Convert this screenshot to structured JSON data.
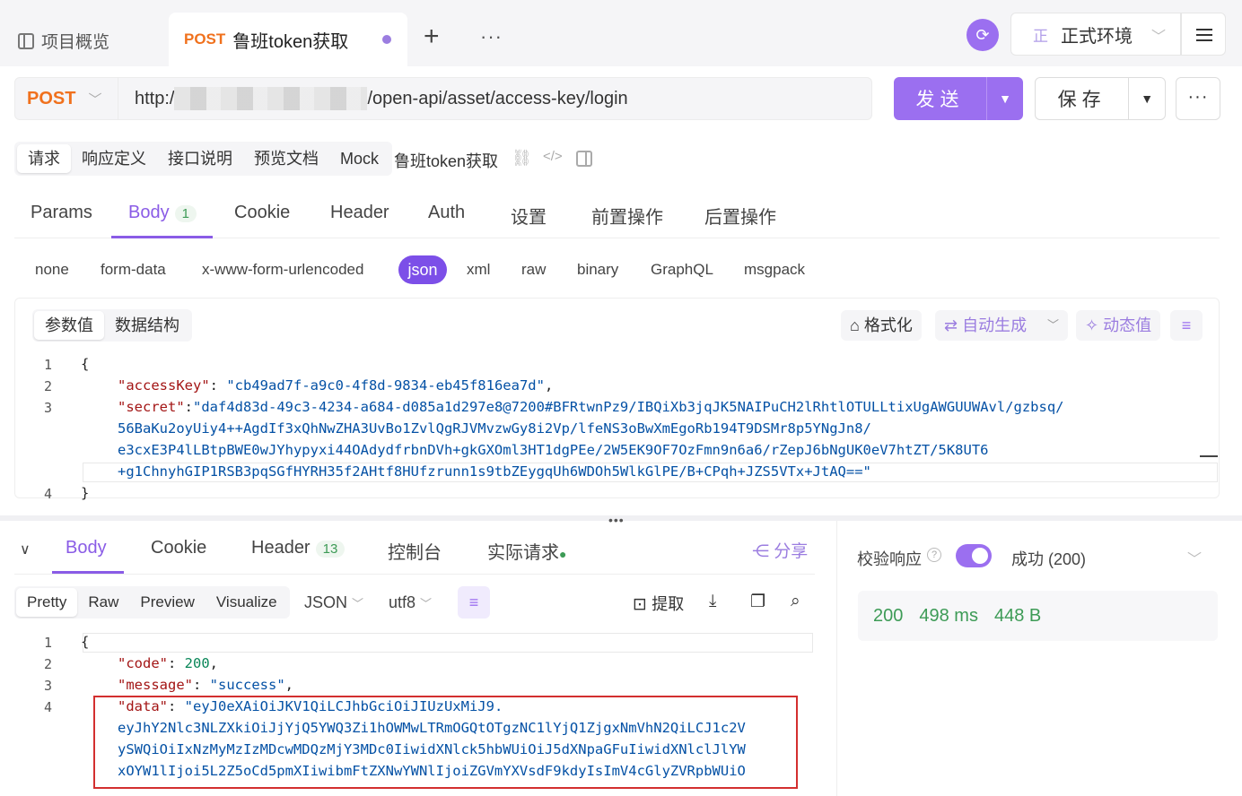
{
  "tabs": {
    "overview_label": "项目概览",
    "active_method": "POST",
    "active_name": "鲁班token获取"
  },
  "top_right": {
    "env_short": "正",
    "env_label": "正式环境"
  },
  "request": {
    "method": "POST",
    "url_prefix": "http:/",
    "url_suffix": "/open-api/asset/access-key/login",
    "send_label": "发送",
    "save_label": "保存"
  },
  "subtabs": [
    "请求",
    "响应定义",
    "接口说明",
    "预览文档",
    "Mock"
  ],
  "api_name": "鲁班token获取",
  "param_tabs": {
    "params": "Params",
    "body": "Body",
    "body_count": "1",
    "cookie": "Cookie",
    "header": "Header",
    "auth": "Auth",
    "settings": "设置",
    "pre": "前置操作",
    "post": "后置操作"
  },
  "body_types": [
    "none",
    "form-data",
    "x-www-form-urlencoded",
    "json",
    "xml",
    "raw",
    "binary",
    "GraphQL",
    "msgpack"
  ],
  "editor_tools": {
    "seg_values": "参数值",
    "seg_schema": "数据结构",
    "format": "格式化",
    "auto_gen": "自动生成",
    "dynamic": "动态值"
  },
  "request_body": {
    "line_numbers": [
      "1",
      "2",
      "3",
      "4"
    ],
    "open": "{",
    "close": "}",
    "access_key_name": "\"accessKey\"",
    "access_key_value": "\"cb49ad7f-a9c0-4f8d-9834-eb45f816ea7d\"",
    "secret_name": "\"secret\"",
    "secret_line1": "\"daf4d83d-49c3-4234-a684-d085a1d297e8@7200#BFRtwnPz9/IBQiXb3jqJK5NAIPuCH2lRhtlOTULLtixUgAWGUUWAvl/gzbsq/",
    "secret_line2": "56BaKu2oyUiy4++AgdIf3xQhNwZHA3UvBo1ZvlQgRJVMvzwGy8i2Vp/lfeNS3oBwXmEgoRb194T9DSMr8p5YNgJn8/",
    "secret_line3": "e3cxE3P4lLBtpBWE0wJYhypyxi44OAdydfrbnDVh+gkGXOml3HT1dgPEe/2W5EK9OF7OzFmn9n6a6/rZepJ6bNgUK0eV7htZT/5K8UT6",
    "secret_line4": "+g1ChnyhGIP1RSB3pqSGfHYRH35f2AHtf8HUfzrunn1s9tbZEygqUh6WDOh5WlkGlPE/B+CPqh+JZS5VTx+JtAQ==\""
  },
  "response_tabs": {
    "body": "Body",
    "cookie": "Cookie",
    "header": "Header",
    "header_count": "13",
    "console": "控制台",
    "actual": "实际请求",
    "share": "分享"
  },
  "response_view": {
    "pretty": "Pretty",
    "raw": "Raw",
    "preview": "Preview",
    "visualize": "Visualize",
    "format": "JSON",
    "encoding": "utf8",
    "extract": "提取"
  },
  "response_body": {
    "line_numbers": [
      "1",
      "2",
      "3",
      "4"
    ],
    "open": "{",
    "code_name": "\"code\"",
    "code_value": "200",
    "message_name": "\"message\"",
    "message_value": "\"success\"",
    "data_name": "\"data\"",
    "data_line1": "\"eyJ0eXAiOiJKV1QiLCJhbGciOiJIUzUxMiJ9.",
    "data_line2": "eyJhY2Nlc3NLZXkiOiJjYjQ5YWQ3Zi1hOWMwLTRmOGQtOTgzNC1lYjQ1ZjgxNmVhN2QiLCJ1c2V",
    "data_line3": "ySWQiOiIxNzMyMzIzMDcwMDQzMjY3MDc0IiwidXNlck5hbWUiOiJ5dXNpaGFuIiwidXNlclJlYW",
    "data_line4": "xOYW1lIjoi5L2Z5oCd5pmXIiwibmFtZXNwYWNlIjoiZGVmYXVsdF9kdyIsImV4cGlyZVRpbWUiO"
  },
  "validation": {
    "label": "校验响应",
    "result": "成功 (200)",
    "status": "200",
    "time": "498 ms",
    "size": "448 B"
  },
  "colors": {
    "accent": "#9b6ff0",
    "method": "#f0711d",
    "success": "#3d9b56",
    "highlight": "#d32f2f"
  }
}
